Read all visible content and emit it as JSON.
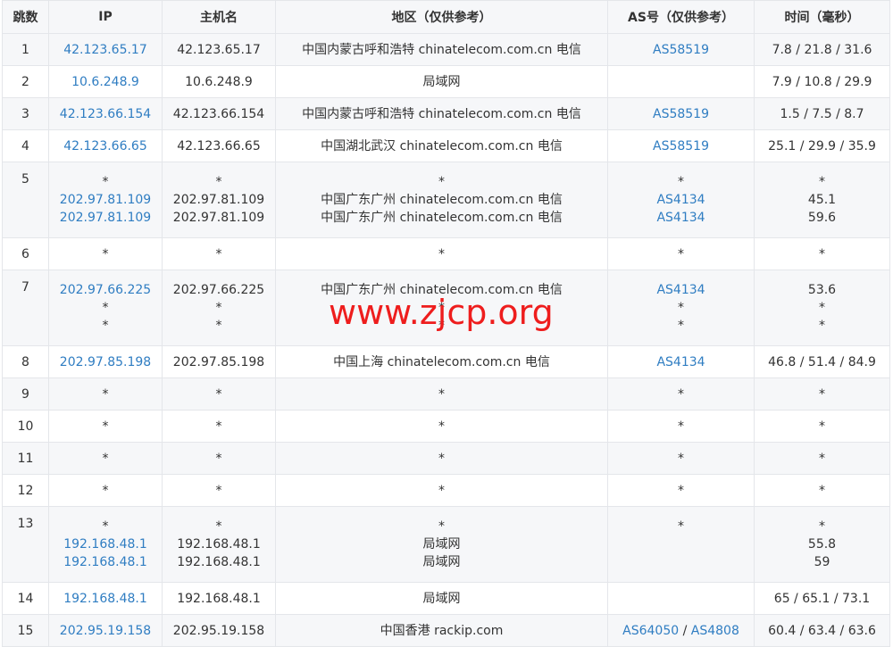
{
  "headers": [
    "跳数",
    "IP",
    "主机名",
    "地区（仅供参考）",
    "AS号（仅供参考）",
    "时间（毫秒）"
  ],
  "rows": [
    {
      "hop": "1",
      "ip": [
        "42.123.65.17"
      ],
      "host": [
        "42.123.65.17"
      ],
      "region": [
        "中国内蒙古呼和浩特 chinatelecom.com.cn 电信"
      ],
      "asn": [
        [
          "AS58519"
        ]
      ],
      "time": [
        "7.8 / 21.8 / 31.6"
      ]
    },
    {
      "hop": "2",
      "ip": [
        "10.6.248.9"
      ],
      "host": [
        "10.6.248.9"
      ],
      "region": [
        "局域网"
      ],
      "asn": [
        []
      ],
      "time": [
        "7.9 / 10.8 / 29.9"
      ]
    },
    {
      "hop": "3",
      "ip": [
        "42.123.66.154"
      ],
      "host": [
        "42.123.66.154"
      ],
      "region": [
        "中国内蒙古呼和浩特 chinatelecom.com.cn 电信"
      ],
      "asn": [
        [
          "AS58519"
        ]
      ],
      "time": [
        "1.5 / 7.5 / 8.7"
      ]
    },
    {
      "hop": "4",
      "ip": [
        "42.123.66.65"
      ],
      "host": [
        "42.123.66.65"
      ],
      "region": [
        "中国湖北武汉 chinatelecom.com.cn 电信"
      ],
      "asn": [
        [
          "AS58519"
        ]
      ],
      "time": [
        "25.1 / 29.9 / 35.9"
      ]
    },
    {
      "hop": "5",
      "ip": [
        "*",
        "202.97.81.109",
        "202.97.81.109"
      ],
      "host": [
        "*",
        "202.97.81.109",
        "202.97.81.109"
      ],
      "region": [
        "*",
        "中国广东广州 chinatelecom.com.cn 电信",
        "中国广东广州 chinatelecom.com.cn 电信"
      ],
      "asn": [
        [
          "*"
        ],
        [
          "AS4134"
        ],
        [
          "AS4134"
        ]
      ],
      "time": [
        "*",
        "45.1",
        "59.6"
      ]
    },
    {
      "hop": "6",
      "ip": [
        "*"
      ],
      "host": [
        "*"
      ],
      "region": [
        "*"
      ],
      "asn": [
        [
          "*"
        ]
      ],
      "time": [
        "*"
      ]
    },
    {
      "hop": "7",
      "ip": [
        "202.97.66.225",
        "*",
        "*"
      ],
      "host": [
        "202.97.66.225",
        "*",
        "*"
      ],
      "region": [
        "中国广东广州 chinatelecom.com.cn 电信",
        "*",
        "*"
      ],
      "asn": [
        [
          "AS4134"
        ],
        [
          "*"
        ],
        [
          "*"
        ]
      ],
      "time": [
        "53.6",
        "*",
        "*"
      ]
    },
    {
      "hop": "8",
      "ip": [
        "202.97.85.198"
      ],
      "host": [
        "202.97.85.198"
      ],
      "region": [
        "中国上海 chinatelecom.com.cn 电信"
      ],
      "asn": [
        [
          "AS4134"
        ]
      ],
      "time": [
        "46.8 / 51.4 / 84.9"
      ]
    },
    {
      "hop": "9",
      "ip": [
        "*"
      ],
      "host": [
        "*"
      ],
      "region": [
        "*"
      ],
      "asn": [
        [
          "*"
        ]
      ],
      "time": [
        "*"
      ]
    },
    {
      "hop": "10",
      "ip": [
        "*"
      ],
      "host": [
        "*"
      ],
      "region": [
        "*"
      ],
      "asn": [
        [
          "*"
        ]
      ],
      "time": [
        "*"
      ]
    },
    {
      "hop": "11",
      "ip": [
        "*"
      ],
      "host": [
        "*"
      ],
      "region": [
        "*"
      ],
      "asn": [
        [
          "*"
        ]
      ],
      "time": [
        "*"
      ]
    },
    {
      "hop": "12",
      "ip": [
        "*"
      ],
      "host": [
        "*"
      ],
      "region": [
        "*"
      ],
      "asn": [
        [
          "*"
        ]
      ],
      "time": [
        "*"
      ]
    },
    {
      "hop": "13",
      "ip": [
        "*",
        "192.168.48.1",
        "192.168.48.1"
      ],
      "host": [
        "*",
        "192.168.48.1",
        "192.168.48.1"
      ],
      "region": [
        "*",
        "局域网",
        "局域网"
      ],
      "asn": [
        [
          "*"
        ],
        [],
        []
      ],
      "time": [
        "*",
        "55.8",
        "59"
      ]
    },
    {
      "hop": "14",
      "ip": [
        "192.168.48.1"
      ],
      "host": [
        "192.168.48.1"
      ],
      "region": [
        "局域网"
      ],
      "asn": [
        []
      ],
      "time": [
        "65 / 65.1 / 73.1"
      ]
    },
    {
      "hop": "15",
      "ip": [
        "202.95.19.158"
      ],
      "host": [
        "202.95.19.158"
      ],
      "region": [
        "中国香港 rackip.com"
      ],
      "asn": [
        [
          "AS64050",
          "AS4808"
        ]
      ],
      "time": [
        "60.4 / 63.4 / 63.6"
      ]
    }
  ],
  "watermark": "www.zjcp.org",
  "colors": {
    "link": "#2f7dc2",
    "watermark": "#ee1d1d",
    "header_bg": "#f6f7f9",
    "border": "#e4e6ea"
  }
}
